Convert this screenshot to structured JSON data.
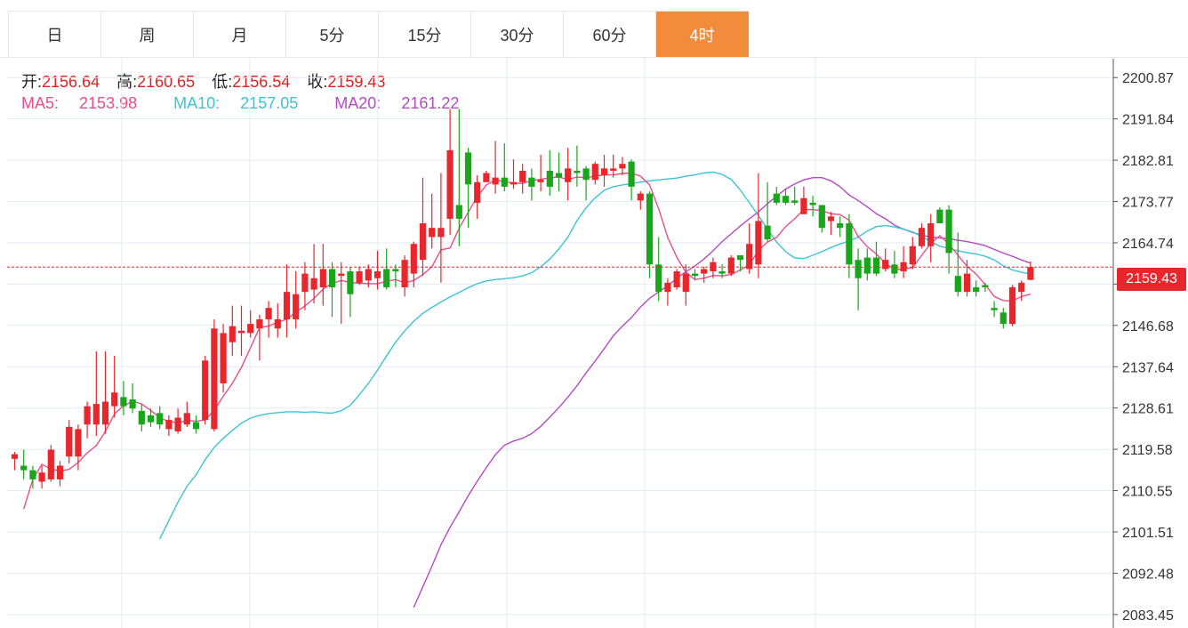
{
  "tabs": [
    {
      "label": "日",
      "active": false
    },
    {
      "label": "周",
      "active": false
    },
    {
      "label": "月",
      "active": false
    },
    {
      "label": "5分",
      "active": false
    },
    {
      "label": "15分",
      "active": false
    },
    {
      "label": "30分",
      "active": false
    },
    {
      "label": "60分",
      "active": false
    },
    {
      "label": "4时",
      "active": true
    }
  ],
  "ohlc": {
    "open_label": "开:",
    "open": "2156.64",
    "high_label": "高:",
    "high": "2160.65",
    "low_label": "低:",
    "low": "2156.54",
    "close_label": "收:",
    "close": "2159.43"
  },
  "ma": {
    "ma5_label": "MA5:",
    "ma5": "2153.98",
    "ma10_label": "MA10:",
    "ma10": "2157.05",
    "ma20_label": "MA20:",
    "ma20": "2161.22"
  },
  "last_price": "2159.43",
  "colors": {
    "up": "#e8262b",
    "down": "#1aa61a",
    "ma5": "#e94e8a",
    "ma10": "#3cc3d4",
    "ma20": "#b44bc4",
    "accent": "#f38b3d",
    "grid": "#e3ebf3"
  },
  "chart_data": {
    "type": "candlestick",
    "ylim": [
      2080.5,
      2205.0
    ],
    "y_ticks": [
      "2200.87",
      "2191.84",
      "2182.81",
      "2173.77",
      "2164.74",
      "2155.71",
      "2146.68",
      "2137.64",
      "2128.61",
      "2119.58",
      "2110.55",
      "2101.51",
      "2092.48",
      "2083.45"
    ],
    "candles": [
      [
        2117.5,
        2118.5,
        2115.0,
        2119.0
      ],
      [
        2116.0,
        2115.0,
        2113.0,
        2119.5
      ],
      [
        2115.0,
        2113.0,
        2111.0,
        2116.0
      ],
      [
        2112.5,
        2114.5,
        2111.0,
        2116.0
      ],
      [
        2113.0,
        2119.5,
        2112.5,
        2120.5
      ],
      [
        2113.0,
        2116.0,
        2111.5,
        2117.0
      ],
      [
        2118.0,
        2124.5,
        2116.5,
        2126.0
      ],
      [
        2118.0,
        2124.0,
        2115.0,
        2125.0
      ],
      [
        2125.0,
        2129.0,
        2122.0,
        2130.0
      ],
      [
        2125.0,
        2129.5,
        2122.5,
        2141.0
      ],
      [
        2125.0,
        2130.0,
        2123.0,
        2141.0
      ],
      [
        2129.0,
        2132.0,
        2126.5,
        2140.0
      ],
      [
        2131.0,
        2129.0,
        2127.0,
        2134.5
      ],
      [
        2130.5,
        2128.5,
        2127.5,
        2134.0
      ],
      [
        2128.0,
        2125.0,
        2123.5,
        2129.5
      ],
      [
        2127.0,
        2125.5,
        2124.5,
        2128.5
      ],
      [
        2127.5,
        2125.0,
        2124.0,
        2129.0
      ],
      [
        2124.0,
        2126.0,
        2122.5,
        2127.0
      ],
      [
        2123.5,
        2126.5,
        2123.0,
        2128.5
      ],
      [
        2125.0,
        2127.5,
        2124.5,
        2130.0
      ],
      [
        2125.5,
        2124.0,
        2123.0,
        2127.0
      ],
      [
        2126.0,
        2139.0,
        2125.0,
        2140.0
      ],
      [
        2124.0,
        2146.0,
        2123.5,
        2148.0
      ],
      [
        2134.0,
        2145.0,
        2132.0,
        2147.0
      ],
      [
        2143.0,
        2146.5,
        2140.0,
        2151.0
      ],
      [
        2145.0,
        2145.5,
        2140.0,
        2151.0
      ],
      [
        2145.0,
        2147.0,
        2144.0,
        2150.0
      ],
      [
        2146.0,
        2148.0,
        2139.0,
        2149.0
      ],
      [
        2148.0,
        2150.5,
        2144.0,
        2152.0
      ],
      [
        2146.0,
        2148.0,
        2144.0,
        2151.5
      ],
      [
        2148.0,
        2154.0,
        2144.0,
        2160.0
      ],
      [
        2148.0,
        2153.5,
        2146.0,
        2158.5
      ],
      [
        2154.0,
        2158.0,
        2150.0,
        2160.5
      ],
      [
        2154.5,
        2157.0,
        2151.5,
        2164.5
      ],
      [
        2155.0,
        2159.0,
        2151.0,
        2164.5
      ],
      [
        2159.0,
        2155.0,
        2148.5,
        2160.5
      ],
      [
        2157.5,
        2158.0,
        2147.0,
        2160.5
      ],
      [
        2158.5,
        2153.5,
        2148.5,
        2159.5
      ],
      [
        2156.0,
        2158.5,
        2155.5,
        2159.5
      ],
      [
        2156.5,
        2159.0,
        2155.0,
        2160.0
      ],
      [
        2157.0,
        2158.5,
        2154.5,
        2163.0
      ],
      [
        2159.0,
        2155.0,
        2154.5,
        2163.5
      ],
      [
        2159.0,
        2158.5,
        2155.0,
        2160.0
      ],
      [
        2155.0,
        2161.0,
        2153.0,
        2162.0
      ],
      [
        2158.0,
        2164.5,
        2155.0,
        2165.0
      ],
      [
        2161.0,
        2169.0,
        2157.5,
        2179.0
      ],
      [
        2166.0,
        2168.0,
        2163.5,
        2175.5
      ],
      [
        2166.0,
        2168.0,
        2156.0,
        2180.0
      ],
      [
        2170.0,
        2185.0,
        2166.5,
        2194.0
      ],
      [
        2173.0,
        2170.0,
        2164.0,
        2194.0
      ],
      [
        2184.5,
        2177.5,
        2168.0,
        2185.5
      ],
      [
        2173.5,
        2178.0,
        2170.0,
        2179.5
      ],
      [
        2178.0,
        2180.0,
        2178.0,
        2180.5
      ],
      [
        2177.5,
        2179.0,
        2175.5,
        2187.0
      ],
      [
        2179.0,
        2177.0,
        2176.0,
        2186.5
      ],
      [
        2177.5,
        2178.0,
        2176.5,
        2183.0
      ],
      [
        2178.0,
        2180.5,
        2175.5,
        2182.0
      ],
      [
        2179.0,
        2177.0,
        2174.0,
        2181.0
      ],
      [
        2178.0,
        2178.5,
        2176.0,
        2184.0
      ],
      [
        2180.5,
        2177.0,
        2175.0,
        2185.0
      ],
      [
        2180.0,
        2179.0,
        2176.0,
        2184.5
      ],
      [
        2178.0,
        2181.0,
        2174.0,
        2185.5
      ],
      [
        2180.5,
        2180.0,
        2177.0,
        2186.0
      ],
      [
        2181.0,
        2178.5,
        2174.0,
        2181.5
      ],
      [
        2178.5,
        2182.0,
        2177.5,
        2182.5
      ],
      [
        2179.5,
        2181.0,
        2177.0,
        2184.0
      ],
      [
        2180.5,
        2181.0,
        2179.0,
        2184.0
      ],
      [
        2181.0,
        2182.0,
        2179.5,
        2183.5
      ],
      [
        2182.5,
        2177.0,
        2174.0,
        2183.0
      ],
      [
        2174.0,
        2175.5,
        2172.0,
        2176.0
      ],
      [
        2175.5,
        2160.0,
        2157.0,
        2176.0
      ],
      [
        2160.0,
        2154.0,
        2152.0,
        2166.0
      ],
      [
        2154.0,
        2156.0,
        2151.0,
        2157.0
      ],
      [
        2155.0,
        2158.5,
        2154.5,
        2159.0
      ],
      [
        2154.0,
        2158.0,
        2151.0,
        2160.0
      ],
      [
        2158.0,
        2157.5,
        2156.5,
        2159.0
      ],
      [
        2158.0,
        2159.0,
        2156.0,
        2159.5
      ],
      [
        2158.5,
        2160.5,
        2157.0,
        2161.5
      ],
      [
        2158.5,
        2158.0,
        2157.0,
        2160.0
      ],
      [
        2158.0,
        2161.5,
        2157.5,
        2162.0
      ],
      [
        2162.0,
        2161.0,
        2158.5,
        2161.5
      ],
      [
        2159.0,
        2164.5,
        2158.0,
        2169.0
      ],
      [
        2160.0,
        2169.5,
        2157.0,
        2180.0
      ],
      [
        2168.5,
        2165.5,
        2165.0,
        2178.0
      ],
      [
        2175.5,
        2173.5,
        2173.0,
        2177.0
      ],
      [
        2175.0,
        2173.5,
        2173.0,
        2176.5
      ],
      [
        2174.0,
        2173.5,
        2173.0,
        2177.0
      ],
      [
        2171.0,
        2174.5,
        2171.0,
        2177.0
      ],
      [
        2173.5,
        2173.0,
        2170.5,
        2175.0
      ],
      [
        2173.0,
        2168.0,
        2167.0,
        2173.0
      ],
      [
        2169.5,
        2170.5,
        2166.5,
        2171.5
      ],
      [
        2169.0,
        2168.0,
        2166.0,
        2170.5
      ],
      [
        2169.0,
        2160.0,
        2157.0,
        2171.0
      ],
      [
        2161.0,
        2157.0,
        2150.0,
        2163.5
      ],
      [
        2161.5,
        2158.0,
        2156.5,
        2163.5
      ],
      [
        2161.5,
        2158.0,
        2157.5,
        2165.0
      ],
      [
        2159.0,
        2161.0,
        2158.5,
        2163.5
      ],
      [
        2160.0,
        2158.0,
        2157.0,
        2163.0
      ],
      [
        2158.5,
        2160.5,
        2157.0,
        2164.0
      ],
      [
        2160.0,
        2164.0,
        2159.0,
        2166.0
      ],
      [
        2164.0,
        2168.0,
        2163.5,
        2169.0
      ],
      [
        2164.0,
        2169.0,
        2160.5,
        2171.0
      ],
      [
        2172.0,
        2169.0,
        2169.0,
        2172.5
      ],
      [
        2172.0,
        2162.5,
        2158.0,
        2173.0
      ],
      [
        2157.5,
        2154.0,
        2153.0,
        2167.0
      ],
      [
        2154.0,
        2158.0,
        2153.0,
        2161.0
      ],
      [
        2155.0,
        2154.0,
        2153.0,
        2156.5
      ],
      [
        2155.5,
        2155.0,
        2154.0,
        2156.0
      ],
      [
        2150.5,
        2150.0,
        2148.5,
        2152.0
      ],
      [
        2149.5,
        2147.0,
        2146.0,
        2150.5
      ],
      [
        2147.0,
        2155.0,
        2146.5,
        2155.5
      ],
      [
        2154.0,
        2156.0,
        2152.0,
        2156.5
      ],
      [
        2156.64,
        2159.43,
        2156.54,
        2160.65
      ]
    ],
    "ma5": [
      2106.5,
      2113.0,
      2116.3,
      2115.3,
      2114.8,
      2115.2,
      2116.7,
      2118.8,
      2120.4,
      2123.5,
      2127.3,
      2129.1,
      2130.1,
      2129.5,
      2128.1,
      2126.4,
      2125.7,
      2125.3,
      2125.9,
      2125.7,
      2126.0,
      2128.1,
      2131.2,
      2134.0,
      2137.5,
      2141.8,
      2146.2,
      2146.5,
      2147.4,
      2148.0,
      2149.6,
      2150.9,
      2152.6,
      2154.6,
      2155.9,
      2156.5,
      2156.1,
      2155.9,
      2155.8,
      2155.8,
      2156.3,
      2156.7,
      2156.0,
      2156.5,
      2157.8,
      2159.5,
      2163.2,
      2163.6,
      2167.9,
      2171.4,
      2174.8,
      2177.4,
      2178.5,
      2178.1,
      2177.8,
      2177.7,
      2178.4,
      2178.6,
      2179.0,
      2179.1,
      2178.6,
      2179.1,
      2179.0,
      2179.3,
      2179.6,
      2179.6,
      2179.9,
      2180.0,
      2179.3,
      2177.4,
      2172.2,
      2165.9,
      2161.6,
      2158.3,
      2156.7,
      2157.0,
      2157.6,
      2157.5,
      2157.8,
      2158.8,
      2159.9,
      2163.1,
      2164.9,
      2165.9,
      2168.3,
      2170.0,
      2172.0,
      2172.0,
      2171.8,
      2171.1,
      2170.9,
      2169.7,
      2166.1,
      2163.9,
      2162.3,
      2160.3,
      2158.9,
      2159.0,
      2159.3,
      2162.0,
      2164.6,
      2166.3,
      2164.5,
      2162.0,
      2159.6,
      2157.9,
      2155.6,
      2153.0,
      2152.1,
      2152.0,
      2153.0,
      2153.5
    ],
    "ma10": [
      2100.0,
      2104.0,
      2108.0,
      2111.5,
      2114.0,
      2117.3,
      2120.0,
      2122.0,
      2123.7,
      2125.3,
      2126.4,
      2127.0,
      2127.4,
      2127.6,
      2127.8,
      2127.8,
      2127.7,
      2127.8,
      2127.6,
      2127.5,
      2128.0,
      2129.2,
      2131.5,
      2134.0,
      2136.9,
      2140.0,
      2143.0,
      2145.5,
      2147.6,
      2149.3,
      2150.6,
      2151.8,
      2152.9,
      2153.9,
      2154.9,
      2155.8,
      2156.4,
      2156.7,
      2156.9,
      2157.1,
      2157.5,
      2158.2,
      2159.5,
      2161.2,
      2163.4,
      2166.0,
      2169.6,
      2172.4,
      2174.6,
      2176.2,
      2177.0,
      2177.4,
      2177.7,
      2178.0,
      2178.3,
      2178.5,
      2178.7,
      2178.9,
      2179.3,
      2179.6,
      2180.0,
      2180.2,
      2179.7,
      2178.6,
      2176.3,
      2173.5,
      2170.7,
      2167.7,
      2164.9,
      2162.8,
      2161.4,
      2161.3,
      2162.0,
      2162.8,
      2163.7,
      2164.5,
      2165.1,
      2166.0,
      2167.3,
      2168.3,
      2168.5,
      2168.2,
      2167.7,
      2167.1,
      2166.1,
      2165.0,
      2164.0,
      2163.5,
      2163.0,
      2162.6,
      2162.3,
      2161.8,
      2161.0,
      2159.7,
      2158.8,
      2158.3,
      2157.9
    ],
    "ma20": [
      2085.0,
      2089.5,
      2094.0,
      2098.7,
      2102.5,
      2105.9,
      2109.4,
      2112.6,
      2115.6,
      2118.4,
      2120.5,
      2121.4,
      2122.0,
      2123.0,
      2124.6,
      2126.6,
      2128.7,
      2131.0,
      2133.5,
      2136.3,
      2138.9,
      2141.6,
      2144.4,
      2146.5,
      2148.4,
      2150.7,
      2152.6,
      2154.0,
      2155.3,
      2157.0,
      2158.4,
      2159.7,
      2161.2,
      2163.0,
      2165.0,
      2166.7,
      2168.4,
      2170.0,
      2171.5,
      2173.3,
      2174.9,
      2176.5,
      2177.6,
      2178.5,
      2179.0,
      2179.0,
      2178.3,
      2177.0,
      2175.2,
      2174.0,
      2172.6,
      2171.1,
      2170.0,
      2168.6,
      2167.7,
      2167.0,
      2166.4,
      2166.0,
      2165.8,
      2165.6,
      2165.3,
      2165.0,
      2164.6,
      2164.1,
      2163.3,
      2162.5,
      2161.8,
      2161.0,
      2160.3
    ]
  }
}
